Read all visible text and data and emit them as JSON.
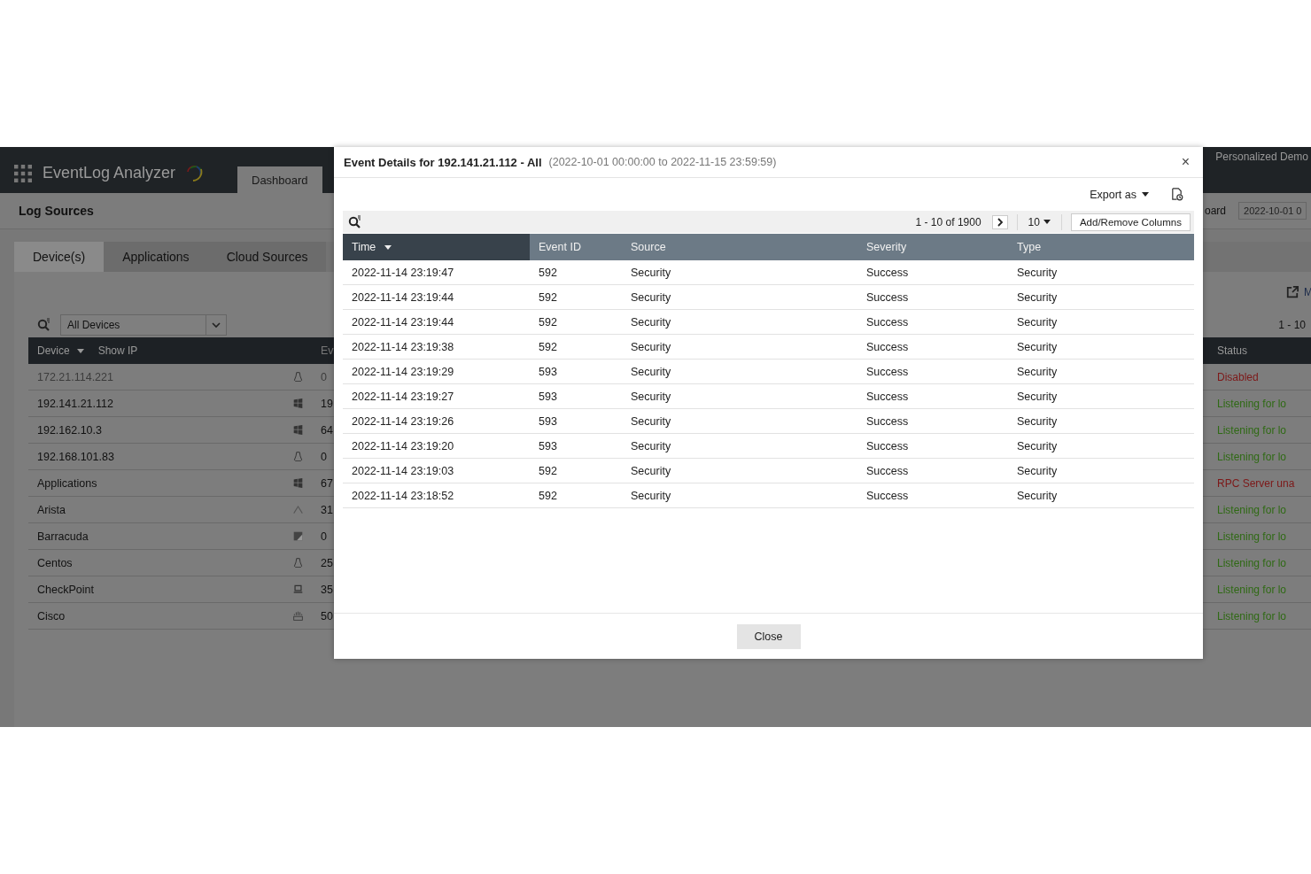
{
  "app": {
    "product_name": "EventLog Analyzer",
    "nav_tabs": [
      {
        "label": "Dashboard",
        "selected": true
      }
    ],
    "header_right": "Personalized Demo"
  },
  "page": {
    "title": "Log Sources",
    "right_label": "oard",
    "date_range": "2022-10-01 0"
  },
  "source_tabs": [
    {
      "label": "Device(s)",
      "selected": true
    },
    {
      "label": "Applications",
      "selected": false
    },
    {
      "label": "Cloud Sources",
      "selected": false
    }
  ],
  "devices": {
    "filter": "All Devices",
    "link": "M",
    "pagination": "1 - 10",
    "columns": {
      "device": "Device",
      "show_ip": "Show IP",
      "column_3": "Ev",
      "status": "Status"
    },
    "rows": [
      {
        "name": "172.21.114.221",
        "disabled": true,
        "kind": "linux",
        "count": "0",
        "status": "Disabled",
        "color": "#7d1818"
      },
      {
        "name": "192.141.21.112",
        "disabled": false,
        "kind": "windows",
        "count": "19",
        "status": "Listening for lo",
        "color": "#2f6a14"
      },
      {
        "name": "192.162.10.3",
        "disabled": false,
        "kind": "windows",
        "count": "64",
        "status": "Listening for lo",
        "color": "#2f6a14"
      },
      {
        "name": "192.168.101.83",
        "disabled": false,
        "kind": "linux",
        "count": "0",
        "status": "Listening for lo",
        "color": "#2f6a14"
      },
      {
        "name": "Applications",
        "disabled": false,
        "kind": "windows",
        "count": "67",
        "status": "RPC Server una",
        "color": "#7d1818"
      },
      {
        "name": "Arista",
        "disabled": false,
        "kind": "arista",
        "count": "31",
        "status": "Listening for lo",
        "color": "#2f6a14"
      },
      {
        "name": "Barracuda",
        "disabled": false,
        "kind": "barracuda",
        "count": "0",
        "status": "Listening for lo",
        "color": "#2f6a14"
      },
      {
        "name": "Centos",
        "disabled": false,
        "kind": "linux",
        "count": "25",
        "status": "Listening for lo",
        "color": "#2f6a14"
      },
      {
        "name": "CheckPoint",
        "disabled": false,
        "kind": "checkpoint",
        "count": "35",
        "status": "Listening for lo",
        "color": "#2f6a14"
      },
      {
        "name": "Cisco",
        "disabled": false,
        "kind": "cisco",
        "count": "50",
        "status": "Listening for lo",
        "color": "#2f6a14"
      }
    ]
  },
  "modal": {
    "title": "Event Details for 192.141.21.112 - All",
    "subtitle": "(2022-10-01 00:00:00 to 2022-11-15 23:59:59)",
    "close_glyph": "×",
    "export": "Export as",
    "pagination": "1 - 10 of 1900",
    "page_size": "10",
    "columns_button": "Add/Remove Columns",
    "columns": [
      {
        "label": "Time",
        "sorted": true
      },
      {
        "label": "Event ID",
        "sorted": false
      },
      {
        "label": "Source",
        "sorted": false
      },
      {
        "label": "Severity",
        "sorted": false
      },
      {
        "label": "Type",
        "sorted": false
      }
    ],
    "rows": [
      [
        "2022-11-14 23:19:47",
        "592",
        "Security",
        "Success",
        "Security"
      ],
      [
        "2022-11-14 23:19:44",
        "592",
        "Security",
        "Success",
        "Security"
      ],
      [
        "2022-11-14 23:19:44",
        "592",
        "Security",
        "Success",
        "Security"
      ],
      [
        "2022-11-14 23:19:38",
        "592",
        "Security",
        "Success",
        "Security"
      ],
      [
        "2022-11-14 23:19:29",
        "593",
        "Security",
        "Success",
        "Security"
      ],
      [
        "2022-11-14 23:19:27",
        "593",
        "Security",
        "Success",
        "Security"
      ],
      [
        "2022-11-14 23:19:26",
        "593",
        "Security",
        "Success",
        "Security"
      ],
      [
        "2022-11-14 23:19:20",
        "593",
        "Security",
        "Success",
        "Security"
      ],
      [
        "2022-11-14 23:19:03",
        "592",
        "Security",
        "Success",
        "Security"
      ],
      [
        "2022-11-14 23:18:52",
        "592",
        "Security",
        "Success",
        "Security"
      ]
    ],
    "close_button": "Close"
  }
}
